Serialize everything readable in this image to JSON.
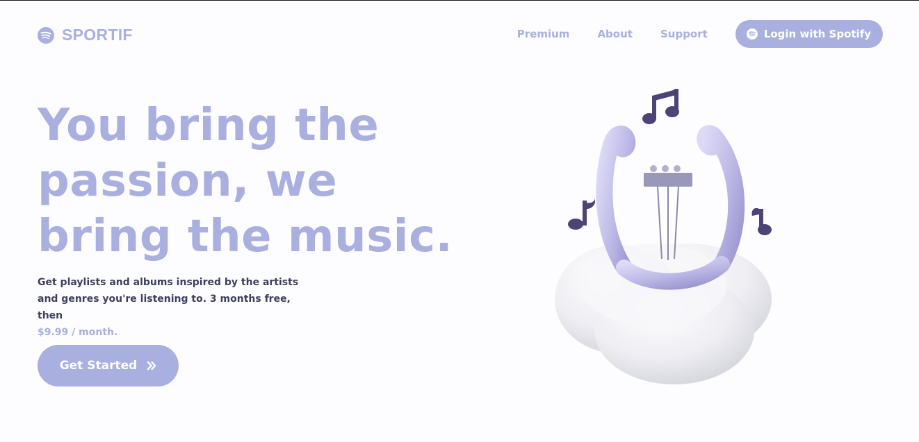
{
  "brand": {
    "name": "SPORTIF",
    "icon": "spotify-logo-icon"
  },
  "nav": {
    "links": [
      "Premium",
      "About",
      "Support"
    ],
    "login_label": "Login with Spotify",
    "login_icon": "spotify-icon"
  },
  "hero": {
    "title": "You bring the passion, we bring the music.",
    "description": "Get playlists and albums inspired by the artists and genres you're listening to. 3 months free, then",
    "price": "$9.99 / month.",
    "cta_label": "Get Started",
    "cta_icon": "double-chevron-right-icon"
  },
  "illustration": {
    "subject": "lyre-on-cloud-with-music-notes"
  },
  "colors": {
    "accent": "#a9b0e0",
    "text_dark": "#3c3f5e",
    "background": "#fdfcfe",
    "note_color": "#4d4377"
  }
}
